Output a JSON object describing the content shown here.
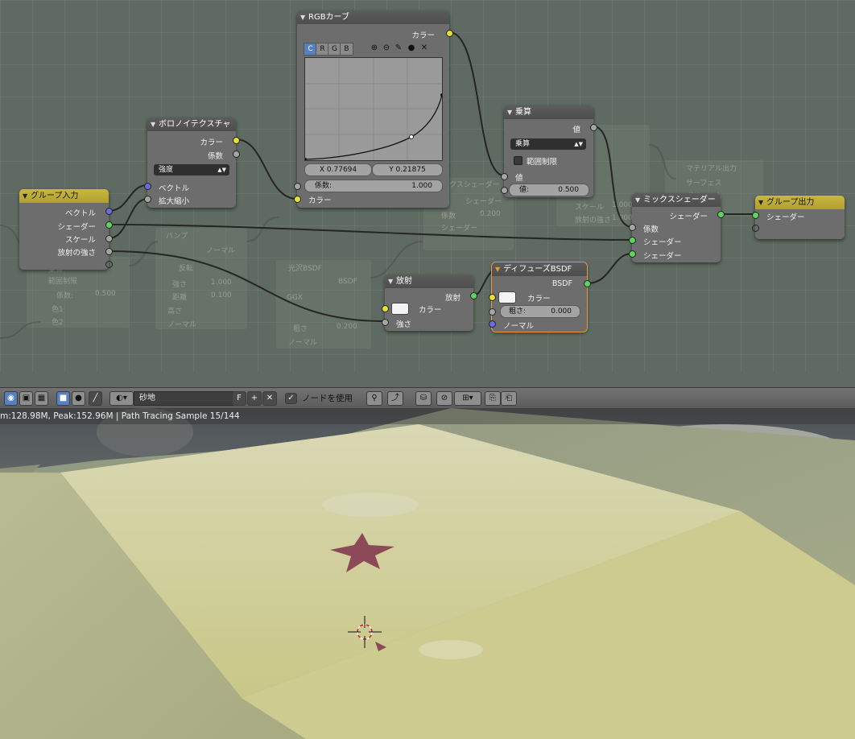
{
  "node_editor": {
    "group_input": {
      "title": "グループ入力",
      "outputs": [
        "ベクトル",
        "シェーダー",
        "スケール",
        "放射の強さ"
      ]
    },
    "voronoi": {
      "title": "ボロノイテクスチャ",
      "outputs": [
        "カラー",
        "係数"
      ],
      "mode": "強度",
      "inputs": [
        "ベクトル",
        "拡大縮小"
      ]
    },
    "rgb_curve": {
      "title": "RGBカーブ",
      "output": "カラー",
      "channels": [
        "C",
        "R",
        "G",
        "B"
      ],
      "x_label": "X 0.77694",
      "y_label": "Y 0.21875",
      "factor_label": "係数:",
      "factor_value": "1.000",
      "input": "カラー"
    },
    "math": {
      "title": "乗算",
      "output": "値",
      "operation": "乗算",
      "clamp_label": "範囲制限",
      "input_label": "値",
      "value_label": "値:",
      "value": "0.500"
    },
    "mix_shader": {
      "title": "ミックスシェーダー",
      "output": "シェーダー",
      "inputs": [
        "係数",
        "シェーダー",
        "シェーダー"
      ]
    },
    "group_output": {
      "title": "グループ出力",
      "input": "シェーダー"
    },
    "emission": {
      "title": "放射",
      "output": "放射",
      "inputs": [
        "カラー",
        "強さ"
      ]
    },
    "diffuse": {
      "title": "ディフューズBSDF",
      "output": "BSDF",
      "color_label": "カラー",
      "roughness_label": "粗さ:",
      "roughness_value": "0.000",
      "normal_label": "ノーマル"
    },
    "background_ghost_text": {
      "bump": "バンプ",
      "normal": "ノーマル",
      "invert": "反転",
      "strength": "強さ",
      "strength_val": "1.000",
      "distance": "距離",
      "distance_val": "0.100",
      "height": "高さ",
      "normal2": "ノーマル",
      "glossy": "光沢BSDF",
      "bsdf": "BSDF",
      "ggx": "GGX",
      "color": "カラー",
      "roughness": "粗さ",
      "roughness_val": "0.200",
      "normal3": "ノーマル",
      "mix": "ミックスシェーダー",
      "shader": "シェーダー",
      "factor": "係数",
      "factor_val": "0.200",
      "material_output": "マテリアル出力",
      "surface": "サーフェス",
      "volume": "ボリューム",
      "displacement": "ディスプレイスメント",
      "scale": "スケール",
      "scale_val": "1.000",
      "emit_strength": "放射の強さ",
      "emit_strength_val": "1.000",
      "mix_rgb": "ミックス",
      "fac": "係数:",
      "fac_val": "0.500",
      "color1": "色1",
      "color2": "色2",
      "clamp": "範囲制限",
      "multiply": "乗算"
    }
  },
  "toolbar": {
    "material_name": "砂地",
    "fake_user": "F",
    "use_nodes_label": "ノードを使用"
  },
  "viewport": {
    "status": "m:128.98M, Peak:152.96M | Path Tracing Sample 15/144"
  },
  "colors": {
    "socket_color": "#e5e033",
    "socket_value": "#a5a5a5",
    "socket_shader": "#5fd25f",
    "socket_vector": "#6b6be0",
    "group_header": "#c9b73f",
    "selected_outline": "#e89a3a"
  }
}
